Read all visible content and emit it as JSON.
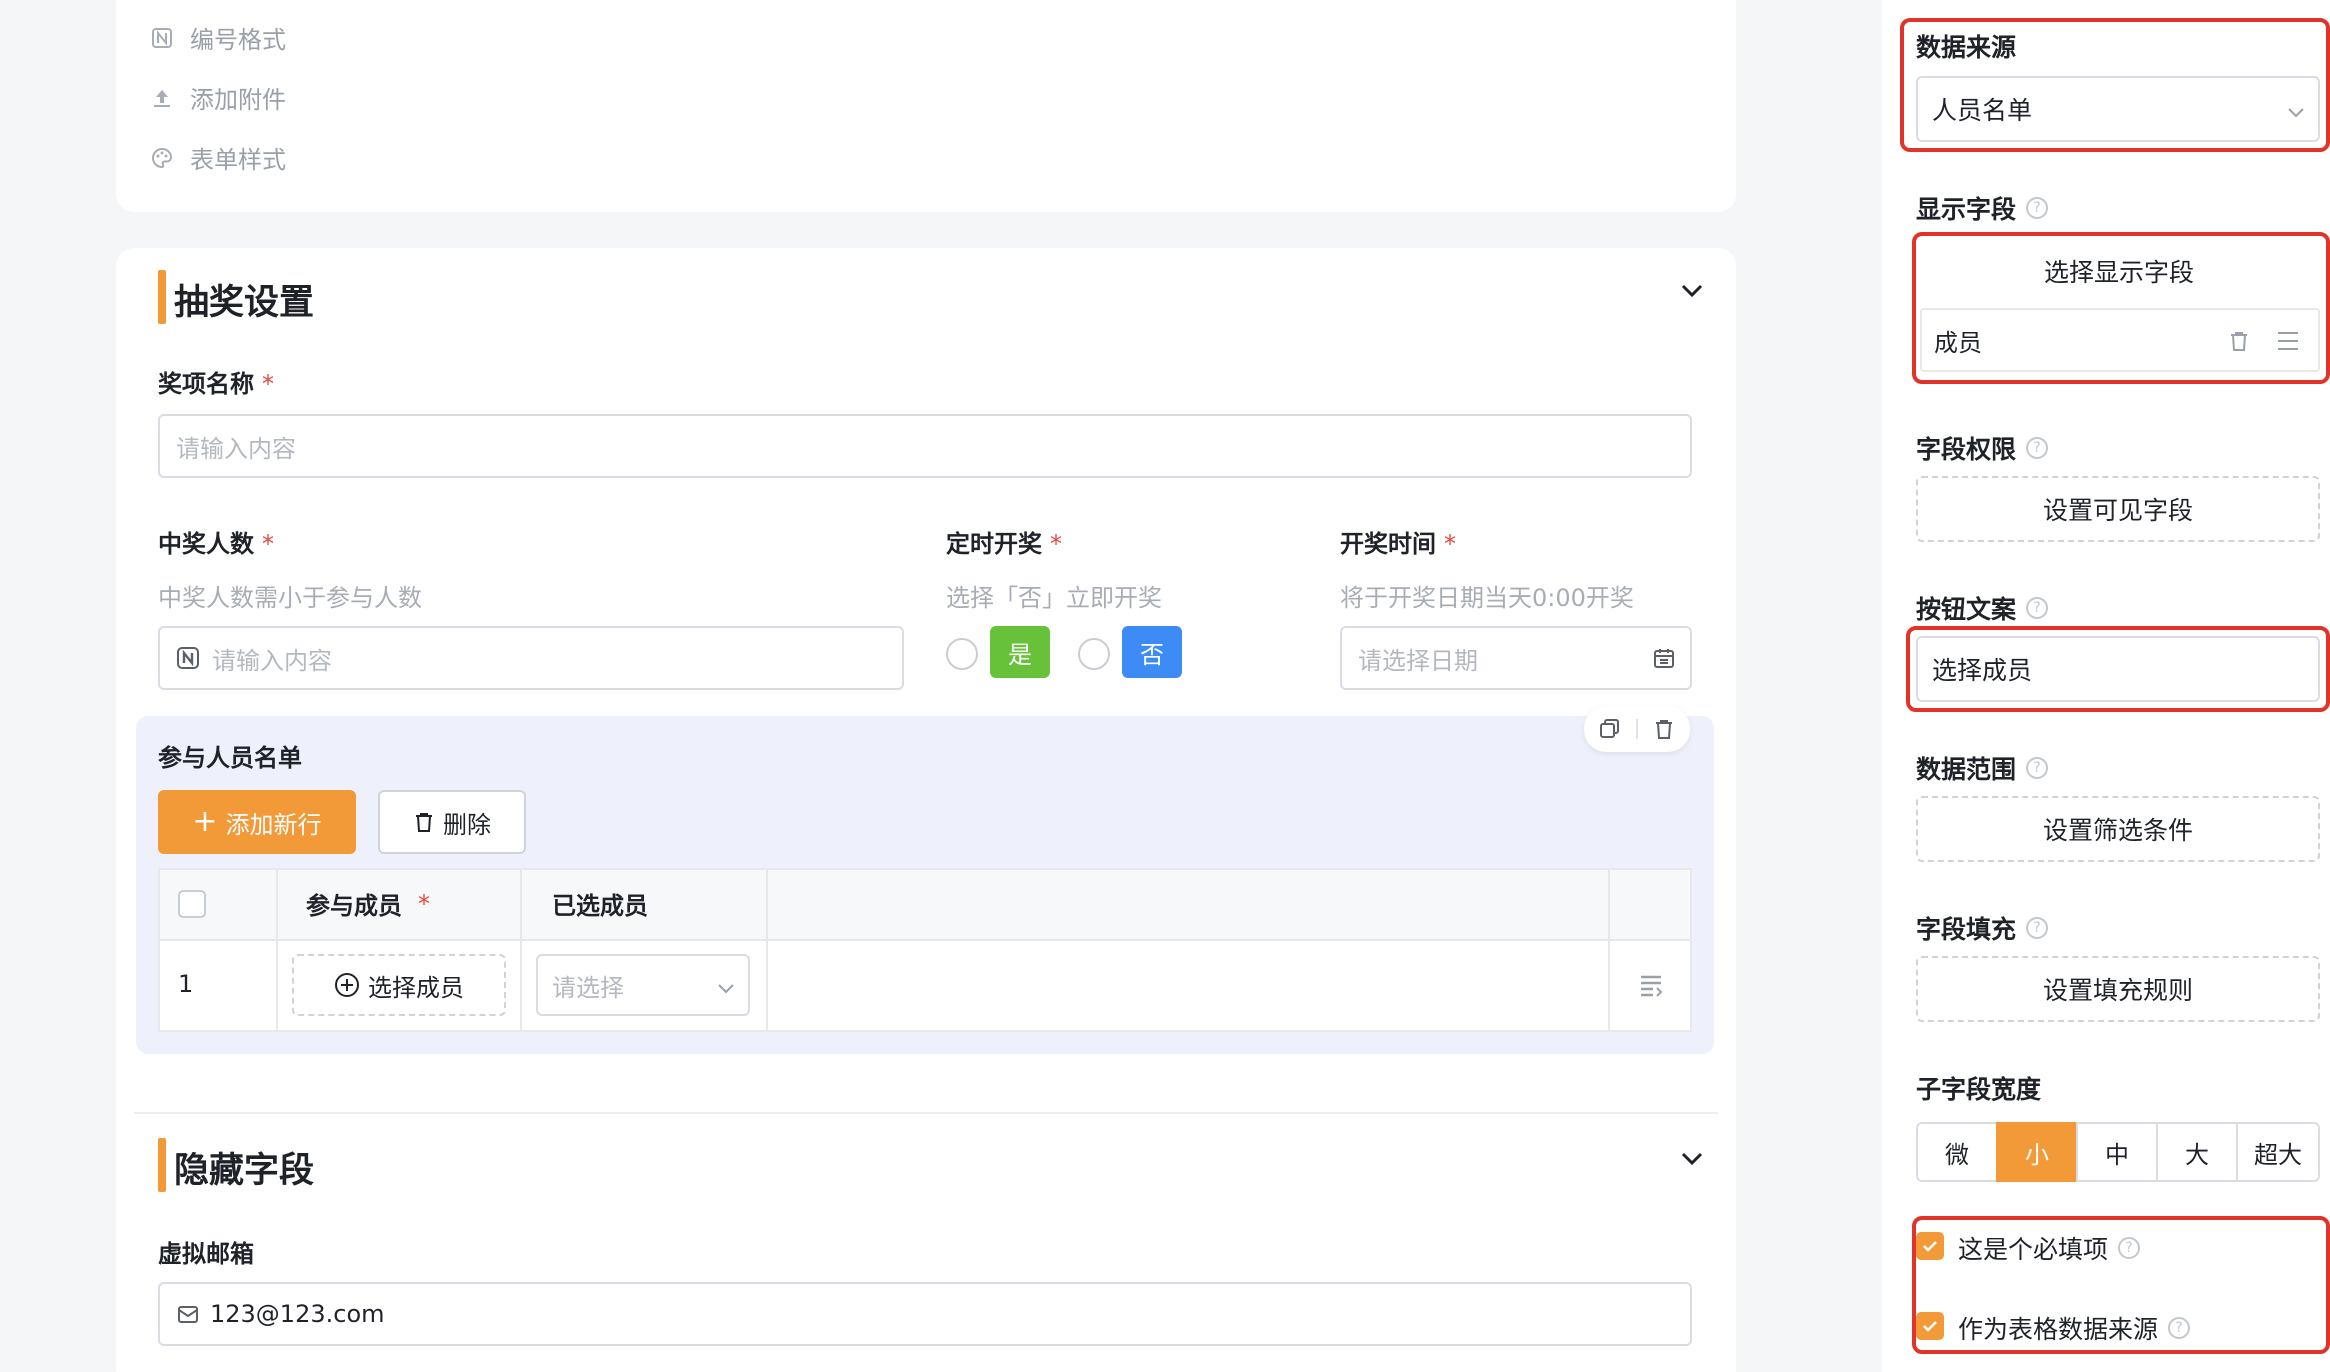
{
  "top_menu": [
    {
      "label": "编号格式",
      "icon": "number-format-icon"
    },
    {
      "label": "添加附件",
      "icon": "upload-icon"
    },
    {
      "label": "表单样式",
      "icon": "palette-icon"
    }
  ],
  "lottery": {
    "title": "抽奖设置",
    "prize_name": {
      "label": "奖项名称",
      "required": "*",
      "placeholder": "请输入内容"
    },
    "winner_count": {
      "label": "中奖人数",
      "required": "*",
      "hint": "中奖人数需小于参与人数",
      "placeholder": "请输入内容"
    },
    "timed_draw": {
      "label": "定时开奖",
      "required": "*",
      "hint": "选择「否」立即开奖",
      "yes": "是",
      "no": "否"
    },
    "draw_time": {
      "label": "开奖时间",
      "required": "*",
      "hint": "将于开奖日期当天0:00开奖",
      "placeholder": "请选择日期"
    },
    "participants": {
      "title": "参与人员名单",
      "add_row": "添加新行",
      "delete": "删除",
      "columns": [
        "参与成员",
        "已选成员"
      ],
      "required": "*",
      "rows": [
        {
          "index": "1",
          "select_member": "选择成员",
          "selected_placeholder": "请选择"
        }
      ]
    }
  },
  "hidden": {
    "title": "隐藏字段",
    "email": {
      "label": "虚拟邮箱",
      "value": "123@123.com"
    }
  },
  "props": {
    "data_source": {
      "label": "数据来源",
      "value": "人员名单"
    },
    "display_field": {
      "label": "显示字段",
      "button": "选择显示字段",
      "item": "成员"
    },
    "field_permission": {
      "label": "字段权限",
      "button": "设置可见字段"
    },
    "button_text": {
      "label": "按钮文案",
      "value": "选择成员"
    },
    "data_range": {
      "label": "数据范围",
      "button": "设置筛选条件"
    },
    "field_fill": {
      "label": "字段填充",
      "button": "设置填充规则"
    },
    "subfield_width": {
      "label": "子字段宽度",
      "options": [
        "微",
        "小",
        "中",
        "大",
        "超大"
      ],
      "selected": "小"
    },
    "required_check": {
      "label": "这是个必填项",
      "checked": true
    },
    "table_source_check": {
      "label": "作为表格数据来源",
      "checked": true
    }
  },
  "colors": {
    "accent": "#f29a38",
    "yes_green": "#67c23a",
    "no_blue": "#3d8cf5",
    "highlight_red": "#e0342a"
  }
}
